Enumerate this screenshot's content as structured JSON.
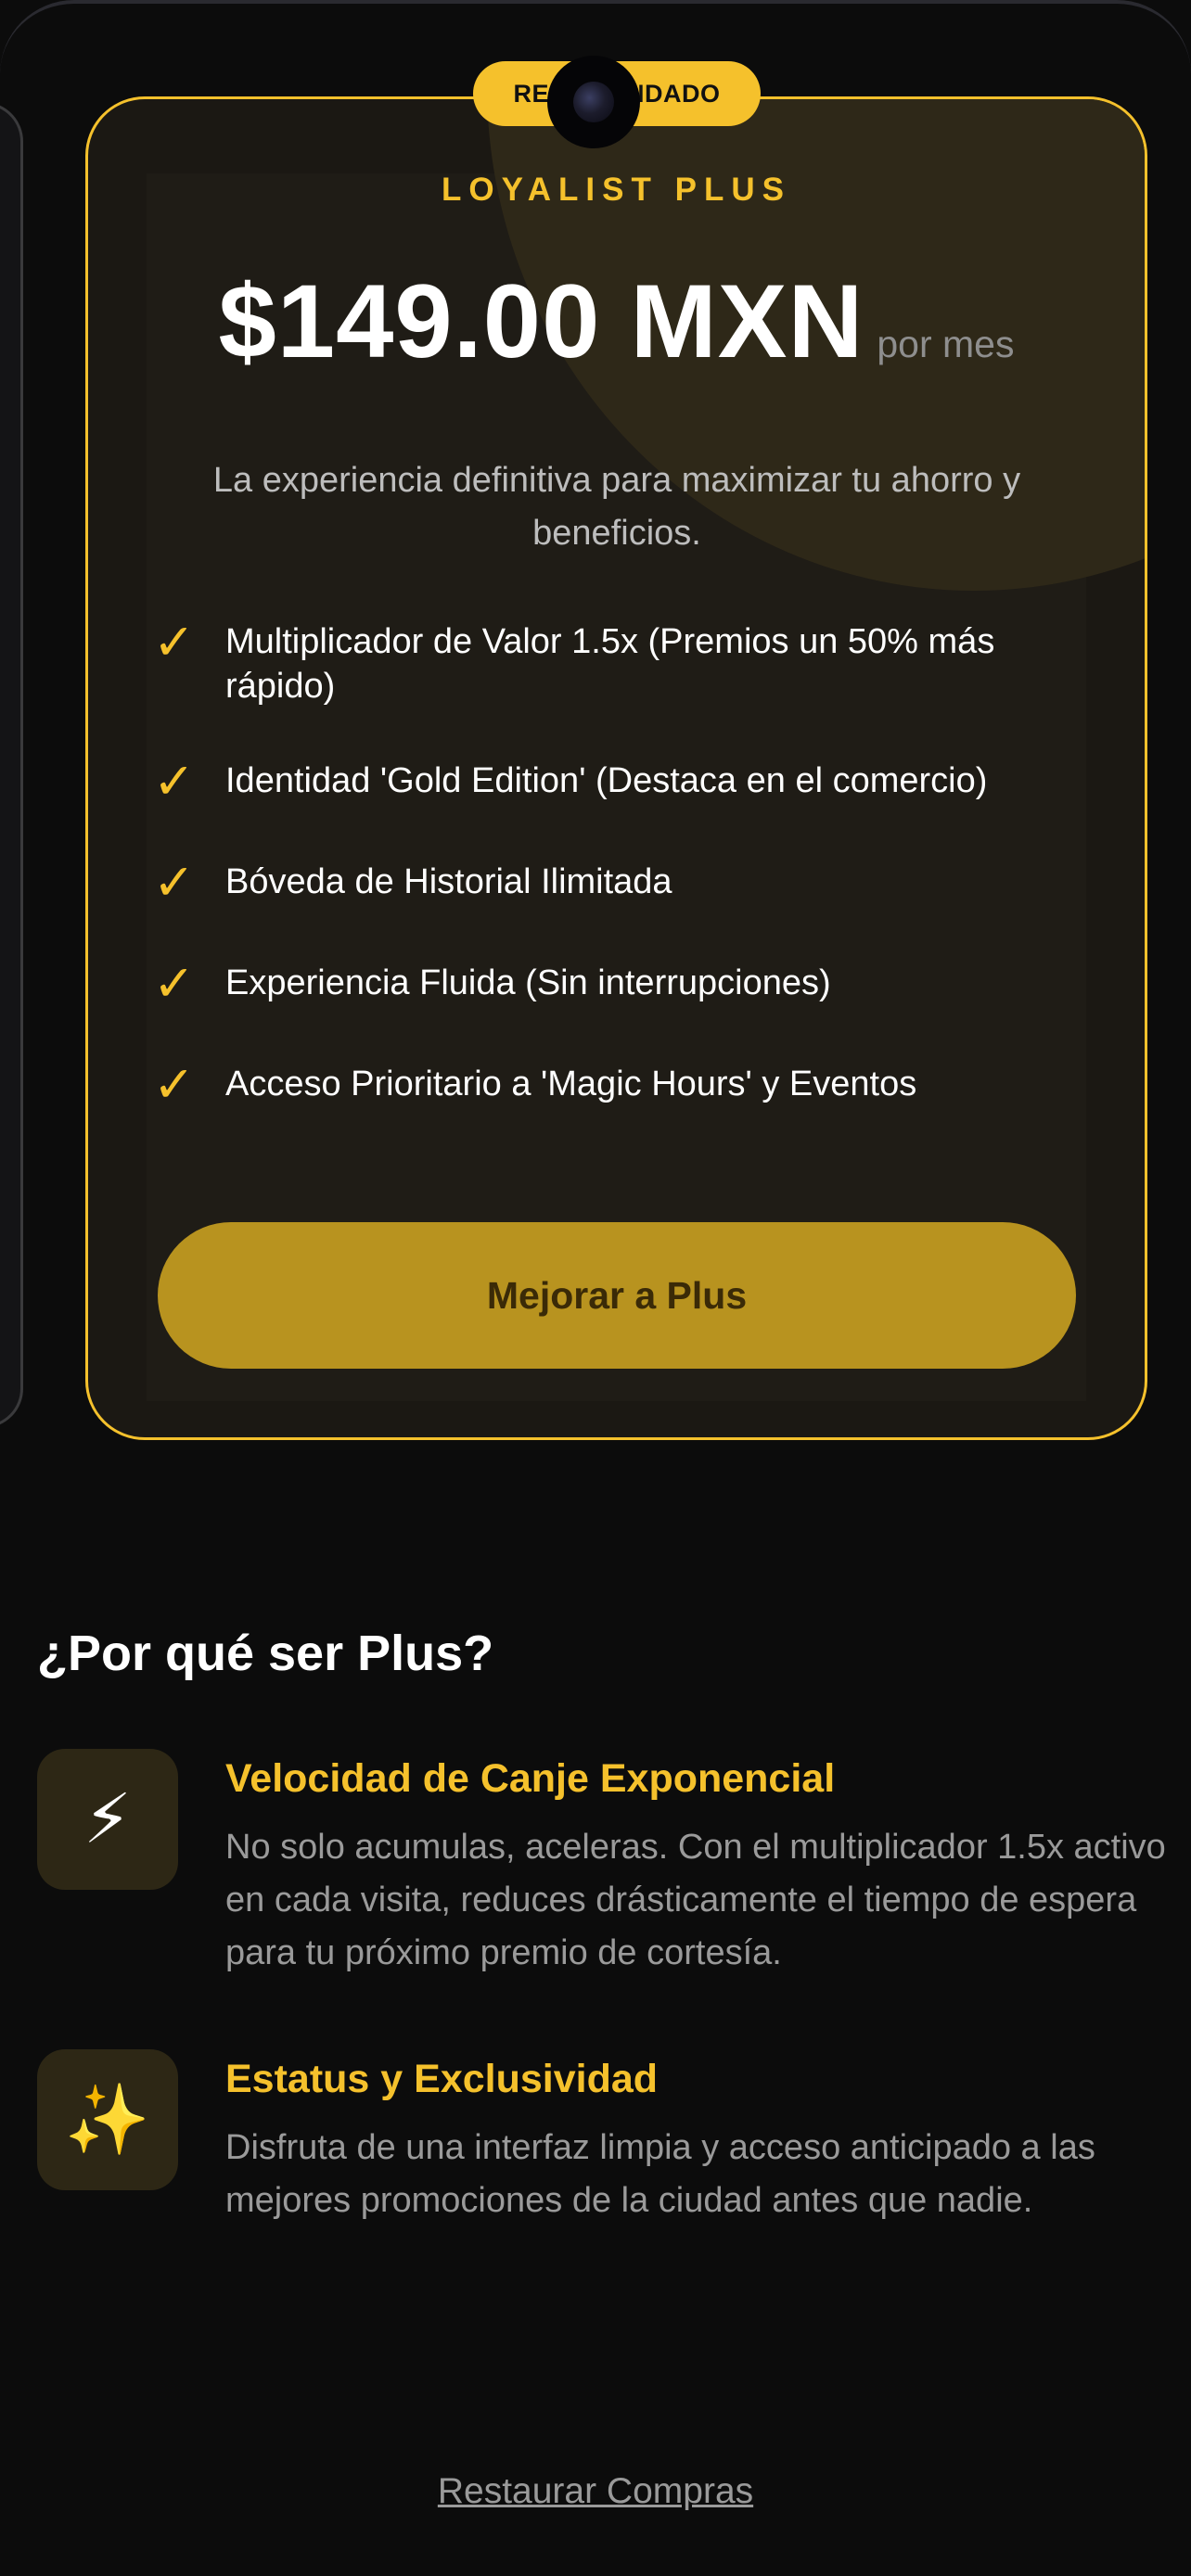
{
  "plan": {
    "badge": "RECOMENDADO",
    "name": "LOYALIST PLUS",
    "price": "$149.00 MXN",
    "period": "por mes",
    "description": "La experiencia definitiva para maximizar tu ahorro y beneficios.",
    "features": [
      "Multiplicador de Valor 1.5x (Premios un 50% más rápido)",
      "Identidad 'Gold Edition' (Destaca en el comercio)",
      "Bóveda de Historial Ilimitada",
      "Experiencia Fluida (Sin interrupciones)",
      "Acceso Prioritario a 'Magic Hours' y Eventos"
    ],
    "check_glyph": "✓",
    "cta_label": "Mejorar a Plus"
  },
  "why": {
    "title": "¿Por qué ser Plus?",
    "benefits": [
      {
        "icon": "⚡",
        "icon_name": "lightning-icon",
        "title": "Velocidad de Canje Exponencial",
        "description": "No solo acumulas, aceleras. Con el multiplicador 1.5x activo en cada visita, reduces drásticamente el tiempo de espera para tu próximo premio de cortesía."
      },
      {
        "icon": "✨",
        "icon_name": "sparkles-icon",
        "title": "Estatus y Exclusividad",
        "description": "Disfruta de una interfaz limpia y acceso anticipado a las mejores promociones de la ciudad antes que nadie."
      }
    ]
  },
  "footer": {
    "restore_label": "Restaurar Compras"
  },
  "colors": {
    "accent": "#f5c12c",
    "cta_background": "#b8931f",
    "background": "#0c0c0c"
  }
}
